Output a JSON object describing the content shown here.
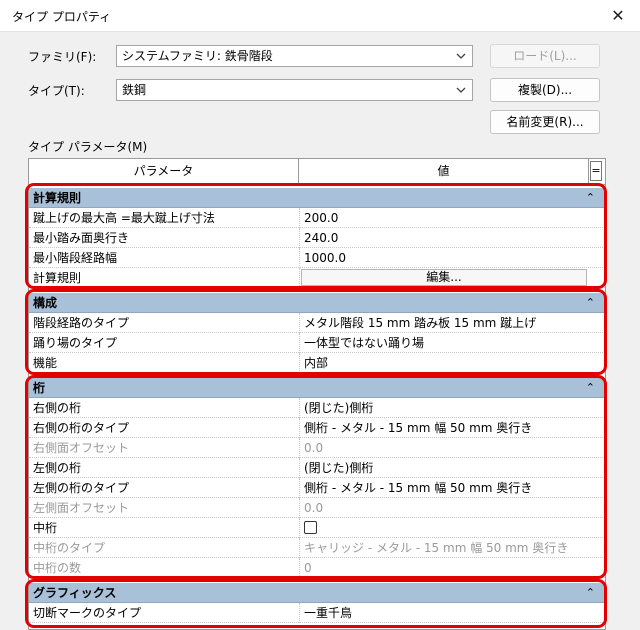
{
  "window": {
    "title": "タイプ プロパティ",
    "close_glyph": "✕"
  },
  "family": {
    "label": "ファミリ(F):",
    "value": "システムファミリ: 鉄骨階段"
  },
  "type": {
    "label": "タイプ(T):",
    "value": "鉄鋼"
  },
  "buttons": {
    "load": "ロード(L)...",
    "duplicate": "複製(D)...",
    "rename": "名前変更(R)..."
  },
  "params_label": "タイプ パラメータ(M)",
  "grid": {
    "header": {
      "param": "パラメータ",
      "value": "値",
      "toggle": "="
    },
    "groups": [
      {
        "name": "計算規則",
        "rows": [
          {
            "name": "蹴上げの最大高 =最大蹴上げ寸法",
            "value": "200.0"
          },
          {
            "name": "最小踏み面奥行き",
            "value": "240.0"
          },
          {
            "name": "最小階段経路幅",
            "value": "1000.0"
          },
          {
            "name": "計算規則",
            "value": "編集..."
          }
        ]
      },
      {
        "name": "構成",
        "rows": [
          {
            "name": "階段経路のタイプ",
            "value": "メタル階段 15 mm 踏み板 15 mm 蹴上げ"
          },
          {
            "name": "踊り場のタイプ",
            "value": "一体型ではない踊り場"
          },
          {
            "name": "機能",
            "value": "内部"
          }
        ]
      },
      {
        "name": "桁",
        "rows": [
          {
            "name": "右側の桁",
            "value": "(閉じた)側桁"
          },
          {
            "name": "右側の桁のタイプ",
            "value": "側桁 - メタル - 15 mm 幅 50 mm 奥行き"
          },
          {
            "name": "右側面オフセット",
            "value": "0.0"
          },
          {
            "name": "左側の桁",
            "value": "(閉じた)側桁"
          },
          {
            "name": "左側の桁のタイプ",
            "value": "側桁 - メタル - 15 mm 幅 50 mm 奥行き"
          },
          {
            "name": "左側面オフセット",
            "value": "0.0"
          },
          {
            "name": "中桁",
            "value": ""
          },
          {
            "name": "中桁のタイプ",
            "value": "キャリッジ - メタル - 15 mm 幅 50 mm 奥行き"
          },
          {
            "name": "中桁の数",
            "value": "0"
          }
        ]
      },
      {
        "name": "グラフィックス",
        "rows": [
          {
            "name": "切断マークのタイプ",
            "value": "一重千鳥"
          }
        ]
      }
    ],
    "collapse_glyph": "⌃"
  },
  "colors": {
    "highlight": "#e30000",
    "group_header": "#a8c0d8"
  }
}
